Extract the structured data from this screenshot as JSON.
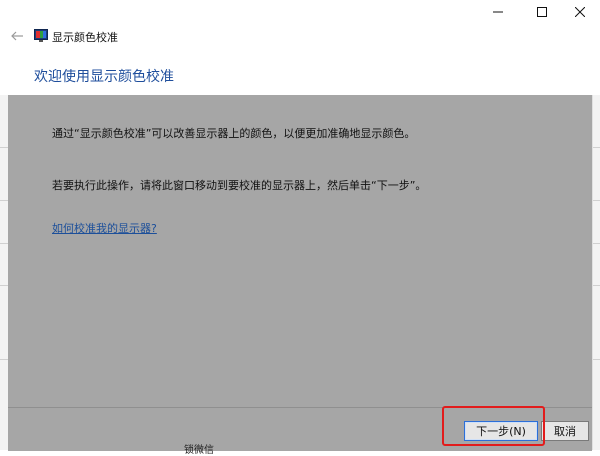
{
  "window": {
    "controls": {
      "minimize": "—",
      "maximize": "☐",
      "close": "✕"
    }
  },
  "nav": {
    "back_glyph": "←",
    "app_title": "显示颜色校准"
  },
  "page": {
    "heading": "欢迎使用显示颜色校准",
    "paragraph1": "通过“显示颜色校准”可以改善显示器上的颜色，以便更加准确地显示颜色。",
    "paragraph2": "若要执行此操作，请将此窗口移动到要校准的显示器上，然后单击“下一步”。",
    "help_link": "如何校准我的显示器?"
  },
  "footer": {
    "next_label": "下一步(N)",
    "cancel_label": "取消"
  },
  "background_fragment": "锁微信"
}
